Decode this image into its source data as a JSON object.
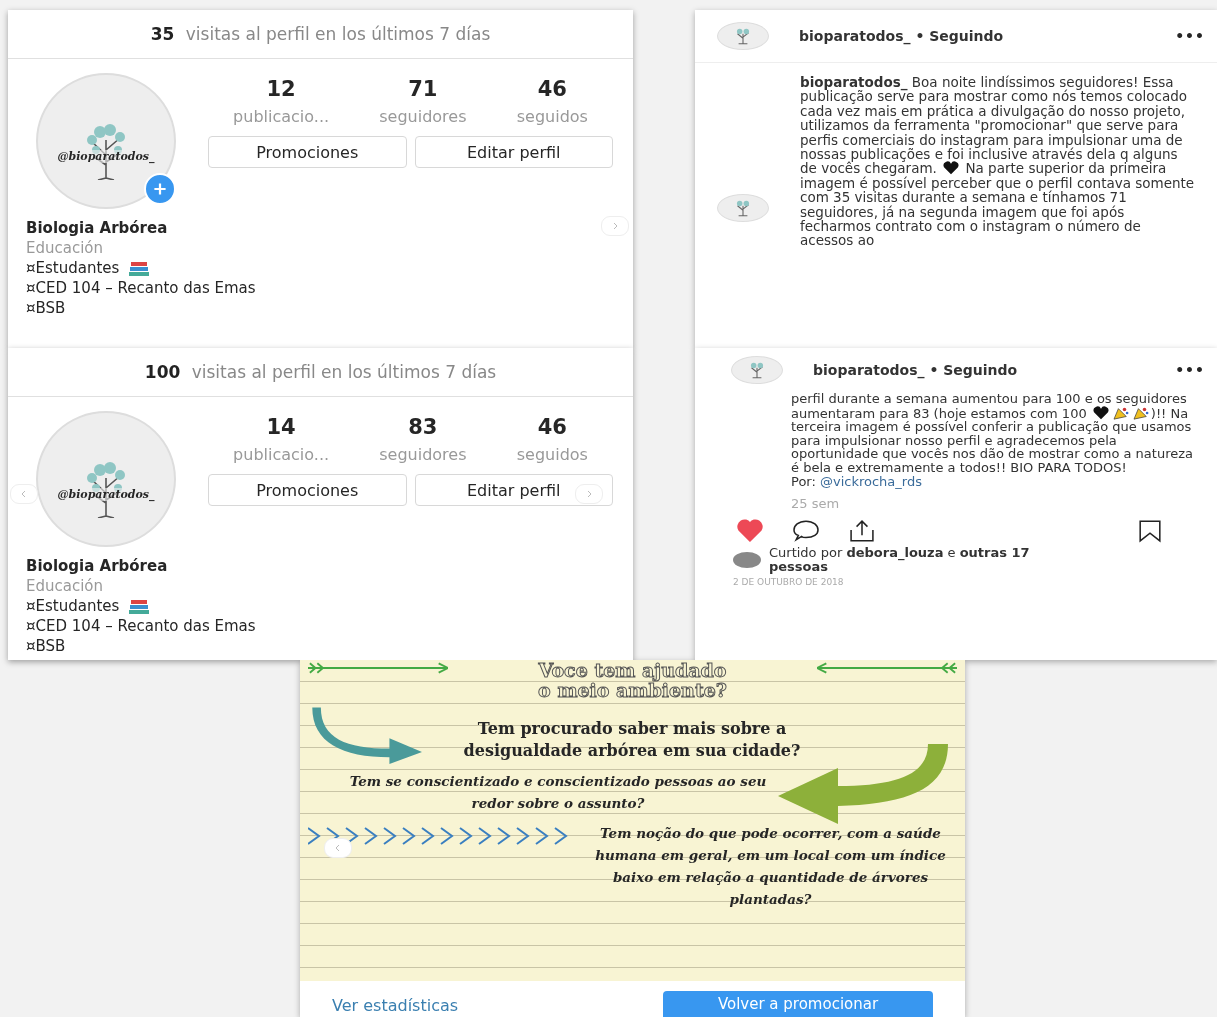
{
  "profile_panels": [
    {
      "visits_count": "35",
      "visits_label": "visitas al perfil en los últimos 7 días",
      "avatar_text": "@bioparatodos_",
      "add_badge": true,
      "stats": [
        {
          "value": "12",
          "label": "publicacio..."
        },
        {
          "value": "71",
          "label": "seguidores"
        },
        {
          "value": "46",
          "label": "seguidos"
        }
      ],
      "buttons": [
        "Promociones",
        "Editar perfil"
      ],
      "name": "Biologia Arbórea",
      "category": "Educación",
      "bio": [
        {
          "text": "¤Estudantes",
          "books": true
        },
        {
          "text": "¤CED 104 – Recanto das Emas",
          "books": false
        },
        {
          "text": "¤BSB",
          "books": false
        }
      ],
      "nav_arrows": [
        {
          "kind": "next"
        }
      ]
    },
    {
      "visits_count": "100",
      "visits_label": "visitas al perfil en los últimos 7 días",
      "avatar_text": "@bioparatodos_",
      "add_badge": false,
      "stats": [
        {
          "value": "14",
          "label": "publicacio..."
        },
        {
          "value": "83",
          "label": "seguidores"
        },
        {
          "value": "46",
          "label": "seguidos"
        }
      ],
      "buttons": [
        "Promociones",
        "Editar perfil"
      ],
      "name": "Biologia Arbórea",
      "category": "Educación",
      "bio": [
        {
          "text": "¤Estudantes",
          "books": true
        },
        {
          "text": "¤CED 104 – Recanto das Emas",
          "books": false
        },
        {
          "text": "¤BSB",
          "books": false
        }
      ],
      "nav_arrows": [
        {
          "kind": "prev"
        },
        {
          "kind": "next"
        }
      ]
    }
  ],
  "post_panels": [
    {
      "header": "bioparatodos_ • Seguindo",
      "menu": "•••",
      "side_avatar": true,
      "caption": [
        {
          "kind": "text",
          "text": "**bioparatodos_** Boa noite lindíssimos seguidores! Essa publicação serve para mostrar como nós temos colocado cada vez mais em prática a divulgação do nosso projeto, utilizamos da ferramenta \"promocionar\" que serve para perfis comerciais do instagram para impulsionar uma de nossas publicações e foi inclusive através dela q alguns de vocês chegaram. "
        },
        {
          "kind": "heart"
        },
        {
          "kind": "text",
          "text": " Na parte superior da primeira imagem é possível perceber que o perfil contava somente com 35 visitas durante a semana e tínhamos 71 seguidores, já na segunda imagem que foi após fecharmos contrato com o instagram o número de acessos ao"
        }
      ]
    },
    {
      "header": "bioparatodos_ • Seguindo",
      "menu": "•••",
      "side_avatar": false,
      "caption": [
        {
          "kind": "text",
          "text": "perfil durante a semana aumentou para 100 e os seguidores aumentaram para 83 (hoje estamos com 100 "
        },
        {
          "kind": "heart"
        },
        {
          "kind": "party"
        },
        {
          "kind": "party"
        },
        {
          "kind": "text",
          "text": ")!! Na terceira imagem é possível conferir a publicação que usamos para impulsionar nosso perfil e agradecemos pela oportunidade que vocês nos dão de mostrar como a natureza é bela e extremamente a todos!! BIO PARA TODOS!"
        },
        {
          "kind": "break"
        },
        {
          "kind": "text",
          "text": "Por: "
        },
        {
          "kind": "link",
          "text": "@vickrocha_rds"
        }
      ],
      "time": "25 sem",
      "liked": true,
      "likes_text": "Curtido por **debora_louza** e **outras 17 pessoas**",
      "date": "2 DE OUTUBRO DE 2018"
    }
  ],
  "promo_panel": {
    "title": [
      "Voce tem ajudado",
      "o meio ambiente?"
    ],
    "question_1": "Tem procurado saber mais sobre a desigualdade arbórea em sua cidade?",
    "question_2": "Tem se conscientizado e conscientizado pessoas ao seu redor sobre o assunto?",
    "question_3": "Tem noção do que pode ocorrer, com a saúde humana em geral, em um local com um índice baixo em relação a quantidade de árvores plantadas?",
    "link": "Ver estadísticas",
    "button": "Volver a promocionar"
  }
}
